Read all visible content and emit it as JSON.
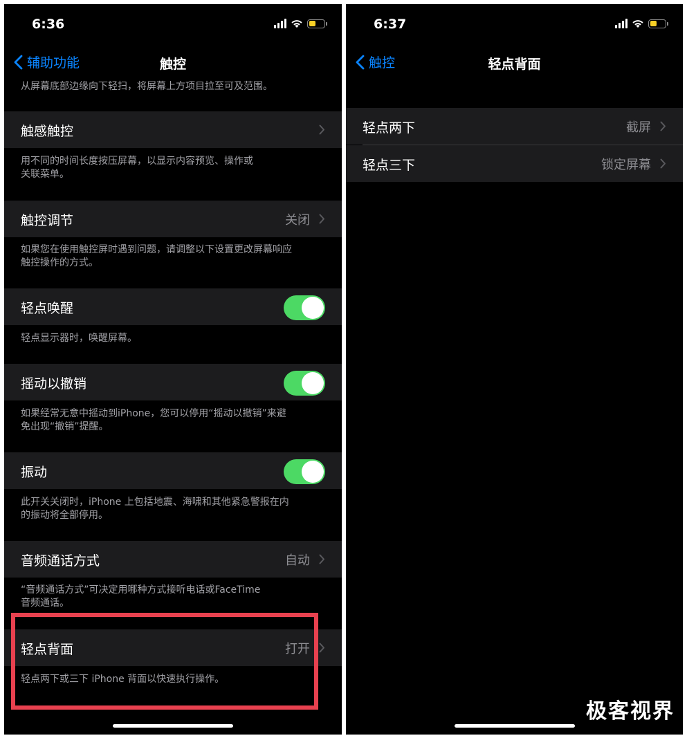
{
  "left_screen": {
    "status": {
      "time": "6:36"
    },
    "nav": {
      "back_label": "辅助功能",
      "title": "触控"
    },
    "top_footer": "从屏幕底部边缘向下轻扫，将屏幕上方项目拉至可及范围。",
    "rows": [
      {
        "label": "触感触控",
        "value": "",
        "footer": "用不同的时间长度按压屏幕，以显示内容预览、操作或\n关联菜单。"
      },
      {
        "label": "触控调节",
        "value": "关闭",
        "footer": "如果您在使用触控屏时遇到问题，请调整以下设置更改屏幕响应\n触控操作的方式。"
      },
      {
        "label": "轻点唤醒",
        "toggle": true,
        "footer": "轻点显示器时，唤醒屏幕。"
      },
      {
        "label": "摇动以撤销",
        "toggle": true,
        "footer": "如果经常无意中摇动到iPhone，您可以停用“摇动以撤销”来避\n免出现“撤销”提醒。"
      },
      {
        "label": "振动",
        "toggle": true,
        "footer": "此开关关闭时，iPhone 上包括地震、海啸和其他紧急警报在内\n的振动将全部停用。"
      },
      {
        "label": "音频通话方式",
        "value": "自动",
        "footer": "“音频通话方式”可决定用哪种方式接听电话或FaceTime\n音频通话。"
      },
      {
        "label": "轻点背面",
        "value": "打开",
        "footer": "轻点两下或三下 iPhone 背面以快速执行操作。"
      }
    ]
  },
  "right_screen": {
    "status": {
      "time": "6:37"
    },
    "nav": {
      "back_label": "触控",
      "title": "轻点背面"
    },
    "rows": [
      {
        "label": "轻点两下",
        "value": "截屏"
      },
      {
        "label": "轻点三下",
        "value": "锁定屏幕"
      }
    ]
  },
  "watermark": "极客视界",
  "colors": {
    "accent": "#0a84ff",
    "toggle_on": "#4cd964",
    "highlight": "#e8414f",
    "row_bg": "#1c1c1e"
  }
}
